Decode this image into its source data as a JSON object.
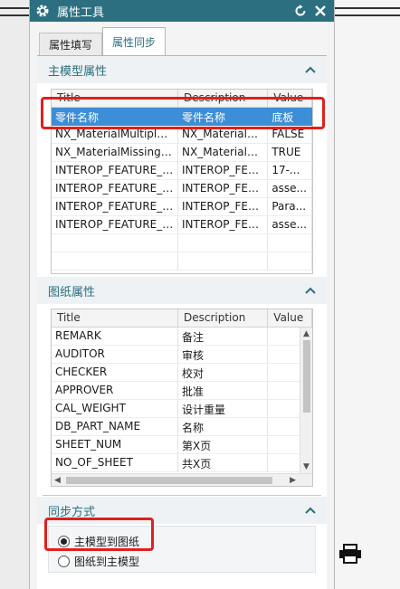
{
  "dialog": {
    "title": "属性工具",
    "tabs": [
      {
        "label": "属性填写",
        "active": false
      },
      {
        "label": "属性同步",
        "active": true
      }
    ]
  },
  "master_attrs": {
    "title": "主模型属性",
    "columns": [
      "Title",
      "Description",
      "Value"
    ],
    "rows": [
      {
        "title": "零件名称",
        "description": "零件名称",
        "value": "底板",
        "selected": true
      },
      {
        "title": "NX_MaterialMultipleAssigned",
        "description": "NX_MaterialM...",
        "value": "FALSE"
      },
      {
        "title": "NX_MaterialMissingAssignments",
        "description": "NX_MaterialM...",
        "value": "TRUE"
      },
      {
        "title": "INTEROP_FEATURE_L...",
        "description": "INTEROP_FEA...",
        "value": "17-..."
      },
      {
        "title": "INTEROP_FEATURE_P...",
        "description": "INTEROP_FEA...",
        "value": "asse..."
      },
      {
        "title": "INTEROP_FEATURE_A...",
        "description": "INTEROP_FEA...",
        "value": "Para..."
      },
      {
        "title": "INTEROP_FEATURE_ID",
        "description": "INTEROP_FEA...",
        "value": "asse..."
      }
    ]
  },
  "drawing_attrs": {
    "title": "图纸属性",
    "columns": [
      "Title",
      "Description",
      "Value"
    ],
    "rows": [
      {
        "title": "REMARK",
        "description": "备注",
        "value": ""
      },
      {
        "title": "AUDITOR",
        "description": "审核",
        "value": ""
      },
      {
        "title": "CHECKER",
        "description": "校对",
        "value": ""
      },
      {
        "title": "APPROVER",
        "description": "批准",
        "value": ""
      },
      {
        "title": "CAL_WEIGHT",
        "description": "设计重量",
        "value": ""
      },
      {
        "title": "DB_PART_NAME",
        "description": "名称",
        "value": ""
      },
      {
        "title": "SHEET_NUM",
        "description": "第X页",
        "value": ""
      },
      {
        "title": "NO_OF_SHEET",
        "description": "共X页",
        "value": ""
      }
    ]
  },
  "sync_mode": {
    "title": "同步方式",
    "options": [
      {
        "label": "主模型到图纸",
        "selected": true
      },
      {
        "label": "图纸到主模型",
        "selected": false
      }
    ]
  },
  "colors": {
    "titlebar": "#2b6f80",
    "accent": "#2b6f80",
    "selection": "#3c8ed6",
    "highlight": "#e0201d"
  },
  "icons": {
    "titlebar": [
      "gear-icon",
      "reset-icon",
      "close-icon"
    ],
    "group": "chevron-up-icon",
    "background_tool": "printer-icon"
  }
}
